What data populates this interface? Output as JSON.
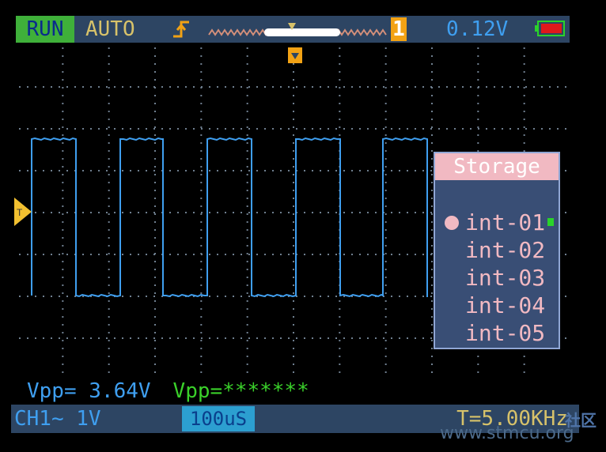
{
  "top_bar": {
    "run_label": "RUN",
    "mode_label": "AUTO",
    "timeline_marker": "T",
    "channel_badge": "1",
    "trigger_level": "0.12V"
  },
  "storage": {
    "title": "Storage",
    "items": [
      "int-01",
      "int-02",
      "int-03",
      "int-04",
      "int-05"
    ],
    "selected_index": 0
  },
  "measurements": {
    "ch1_vpp": "Vpp=  3.64V",
    "ch2_vpp": "Vpp=*******"
  },
  "bottom_bar": {
    "channel_scale": "CH1~  1V",
    "time_scale": "100uS",
    "frequency": "T=5.00KHz"
  },
  "watermark": {
    "site": "www.stmcu.org",
    "tag": "社区"
  },
  "colors": {
    "bar_bg": "#2d4563",
    "run_green": "#3fb03a",
    "trace_blue": "#3f9ff0",
    "menu_pink": "#f1b9c2"
  }
}
